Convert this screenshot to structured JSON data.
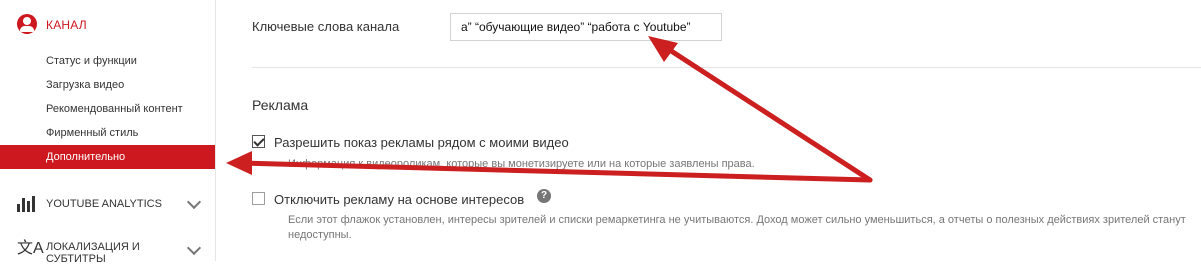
{
  "sidebar": {
    "channel_label": "КАНАЛ",
    "items": [
      {
        "label": "Статус и функции"
      },
      {
        "label": "Загрузка видео"
      },
      {
        "label": "Рекомендованный контент"
      },
      {
        "label": "Фирменный стиль"
      },
      {
        "label": "Дополнительно",
        "active": true
      }
    ],
    "analytics_label": "YOUTUBE ANALYTICS",
    "localization_label_line1": "ЛОКАЛИЗАЦИЯ И",
    "localization_label_line2": "СУБТИТРЫ",
    "active_color": "#cc181e"
  },
  "main": {
    "keywords_label": "Ключевые слова канала",
    "keywords_value": "а” “обучающие видео” “работа с Youtube”",
    "ads_title": "Реклама",
    "allow_ads": {
      "label": "Разрешить показ рекламы рядом с моими видео",
      "checked": true,
      "description": "Информация к видеороликам, которые вы монетизируете или на которые заявлены права."
    },
    "disable_interest_ads": {
      "label": "Отключить рекламу на основе интересов",
      "checked": false,
      "description": "Если этот флажок установлен, интересы зрителей и списки ремаркетинга не учитываются. Доход может сильно уменьшиться, а отчеты о полезных действиях зрителей станут недоступны."
    }
  },
  "icons": {
    "channel": "avatar-icon",
    "analytics": "bar-chart-icon",
    "localization": "translate-icon",
    "help": "help-icon"
  },
  "colors": {
    "accent": "#cc181e",
    "arrow": "#cc1f1f"
  }
}
